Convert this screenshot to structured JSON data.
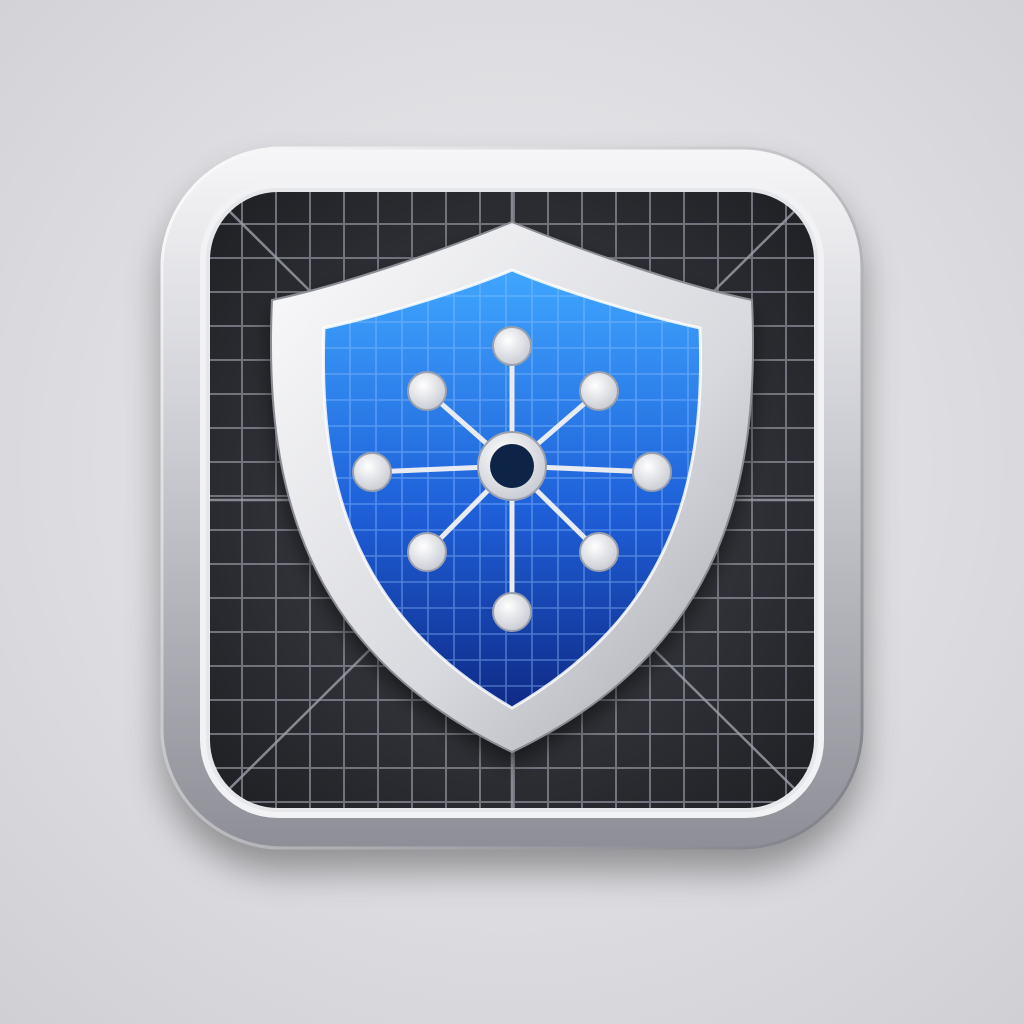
{
  "icon": {
    "kind": "app-icon",
    "subject": "shield-network-icon",
    "colors": {
      "background": "#dcdce0",
      "frame_light": "#f4f4f6",
      "frame_dark": "#8f9097",
      "inner_panel": "#2b2c31",
      "grid_line": "#8a8d96",
      "shield_rim": "#e9eaee",
      "shield_blue_light": "#3fa0ff",
      "shield_blue_dark": "#102c8c",
      "hub_center": "#0d2446",
      "node_fill": "#eceef2"
    },
    "network": {
      "center_node": 1,
      "outer_nodes": 8
    }
  }
}
